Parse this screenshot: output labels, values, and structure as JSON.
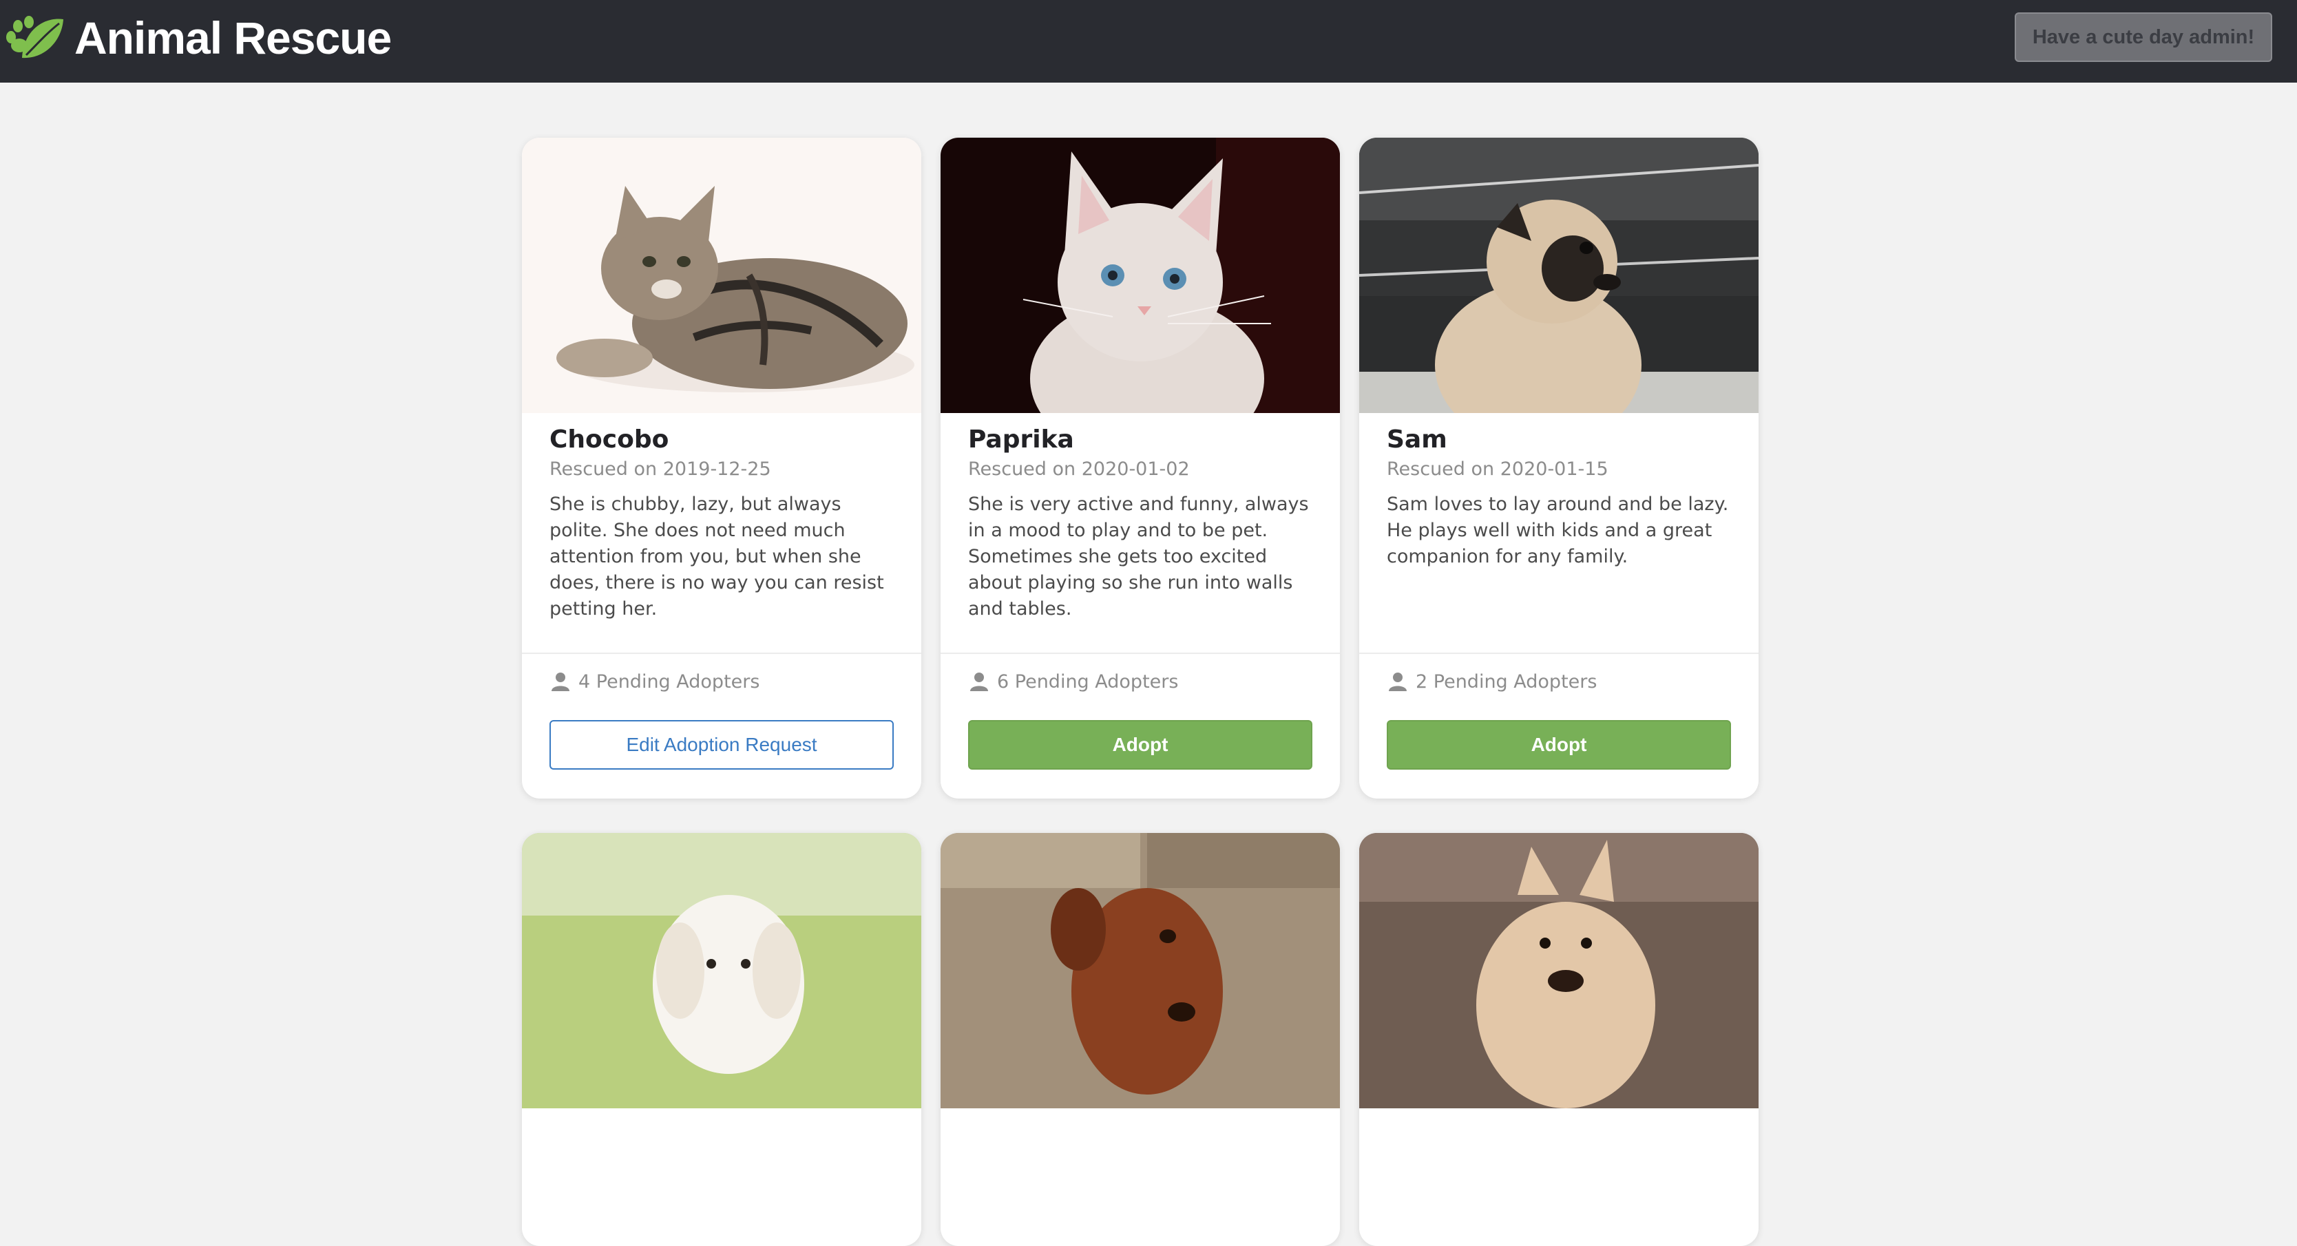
{
  "app": {
    "brand": "Animal Rescue",
    "greeting_button": "Have a cute day admin!",
    "colors": {
      "navbar": "#2a2c32",
      "adopt_green": "#78b057",
      "edit_blue": "#3a7bc3",
      "page_bg": "#f2f2f2"
    }
  },
  "icons": {
    "logo": "paw-leaf-icon",
    "pending": "person-icon"
  },
  "animals": [
    {
      "name": "Chocobo",
      "rescued": "Rescued on 2019-12-25",
      "description": "She is chubby, lazy, but always polite. She does not need much attention from you, but when she does, there is no way you can resist petting her.",
      "pending": "4 Pending Adopters",
      "action": "Edit Adoption Request"
    },
    {
      "name": "Paprika",
      "rescued": "Rescued on 2020-01-02",
      "description": "She is very active and funny, always in a mood to play and to be pet. Sometimes she gets too excited about playing so she run into walls and tables.",
      "pending": "6 Pending Adopters",
      "action": "Adopt"
    },
    {
      "name": "Sam",
      "rescued": "Rescued on 2020-01-15",
      "description": "Sam loves to lay around and be lazy. He plays well with kids and a great companion for any family.",
      "pending": "2 Pending Adopters",
      "action": "Adopt"
    }
  ]
}
